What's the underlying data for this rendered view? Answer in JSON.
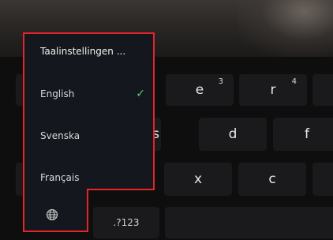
{
  "language_menu": {
    "title": "Taalinstellingen ...",
    "items": [
      {
        "label": "English",
        "selected": true
      },
      {
        "label": "Svenska",
        "selected": false
      },
      {
        "label": "Français",
        "selected": false
      }
    ],
    "check_mark": "✓",
    "globe_icon": "globe-icon",
    "highlight_color": "#e2262a",
    "check_color": "#58c98a"
  },
  "keyboard": {
    "row1": [
      {
        "label": "e",
        "hint": "3"
      },
      {
        "label": "r",
        "hint": "4"
      }
    ],
    "row2": [
      {
        "label": "s"
      },
      {
        "label": "d"
      },
      {
        "label": "f"
      }
    ],
    "row3": [
      {
        "label": "x"
      },
      {
        "label": "c"
      }
    ],
    "bottom": {
      "symbols_label": ".?123"
    }
  }
}
